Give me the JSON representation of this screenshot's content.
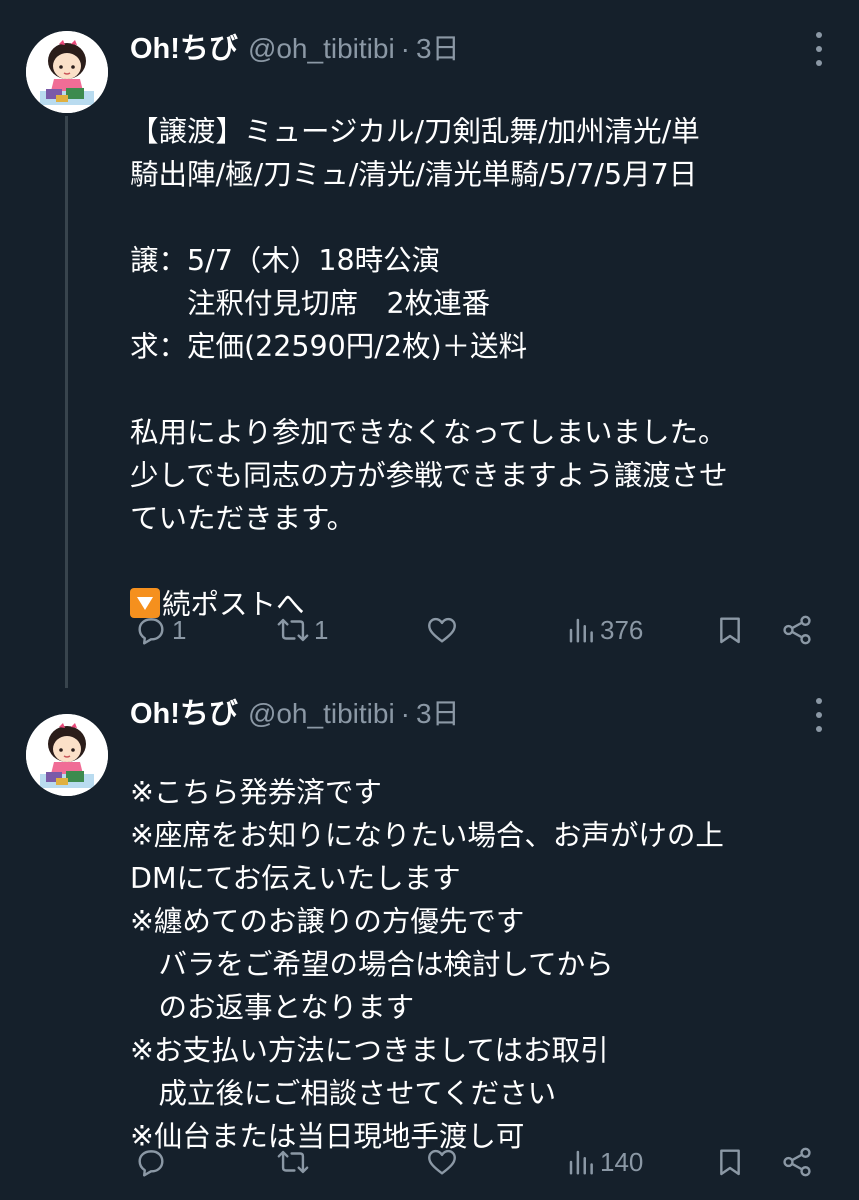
{
  "tweets": [
    {
      "author": {
        "name": "Oh!ちび",
        "handle": "@oh_tibitibi"
      },
      "separator": "·",
      "time": "3日",
      "lines": [
        "【譲渡】ミュージカル/刀剣乱舞/加州清光/単",
        "騎出陣/極/刀ミュ/清光/清光単騎/5/7/5月7日",
        "",
        "譲：5/7（木）18時公演",
        "　　注釈付見切席　2枚連番",
        "求：定価(22590円/2枚)＋送料",
        "",
        "私用により参加できなくなってしまいました。",
        "少しでも同志の方が参戦できますよう譲渡させ",
        "ていただきます。",
        ""
      ],
      "last_line": "続ポストへ",
      "last_line_icon": "down-arrow-emoji",
      "stats": {
        "replies": "1",
        "reposts": "1",
        "likes": "",
        "views": "376"
      }
    },
    {
      "author": {
        "name": "Oh!ちび",
        "handle": "@oh_tibitibi"
      },
      "separator": "·",
      "time": "3日",
      "lines": [
        "※こちら発券済です",
        "※座席をお知りになりたい場合、お声がけの上",
        "DMにてお伝えいたします",
        "※纏めてのお譲りの方優先です",
        "　バラをご希望の場合は検討してから",
        "　のお返事となります",
        "※お支払い方法につきましてはお取引",
        "　成立後にご相談させてください",
        "※仙台または当日現地手渡し可"
      ],
      "stats": {
        "replies": "",
        "reposts": "",
        "likes": "",
        "views": "140"
      }
    }
  ],
  "colors": {
    "background": "#15202b",
    "text": "#ffffff",
    "secondary": "#8b98a5",
    "thread_line": "#38444d",
    "emoji": "#f5901e"
  }
}
